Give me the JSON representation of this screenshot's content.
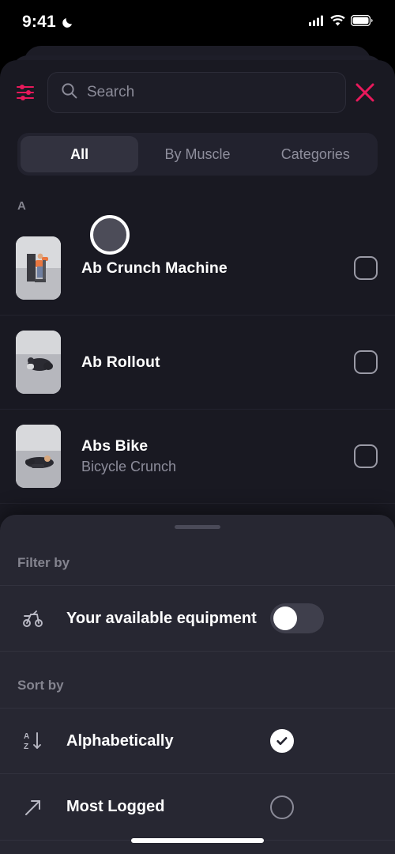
{
  "status_bar": {
    "time": "9:41",
    "moon_icon": "crescent-moon-icon",
    "signal_icon": "cellular-signal-icon",
    "wifi_icon": "wifi-icon",
    "battery_icon": "battery-full-icon"
  },
  "header": {
    "filter_icon": "sliders-filter-icon",
    "search_placeholder": "Search",
    "search_value": "",
    "search_icon": "magnifier-icon",
    "close_icon": "close-x-icon",
    "accent_color": "#e8195b"
  },
  "tabs": [
    {
      "label": "All",
      "active": true
    },
    {
      "label": "By Muscle",
      "active": false
    },
    {
      "label": "Categories",
      "active": false
    }
  ],
  "list": {
    "section_letter": "A",
    "items": [
      {
        "name": "Ab Crunch Machine",
        "subtitle": "",
        "checked": false,
        "thumb": "ab-crunch-machine-photo"
      },
      {
        "name": "Ab Rollout",
        "subtitle": "",
        "checked": false,
        "thumb": "ab-rollout-photo"
      },
      {
        "name": "Abs Bike",
        "subtitle": "Bicycle Crunch",
        "checked": false,
        "thumb": "abs-bike-photo"
      }
    ]
  },
  "bottom_sheet": {
    "filter_label": "Filter by",
    "filter_options": [
      {
        "label": "Your available equipment",
        "icon": "exercise-bike-icon",
        "enabled": false
      }
    ],
    "sort_label": "Sort by",
    "sort_options": [
      {
        "label": "Alphabetically",
        "icon": "sort-az-icon",
        "selected": true
      },
      {
        "label": "Most Logged",
        "icon": "arrow-up-right-icon",
        "selected": false
      }
    ]
  }
}
